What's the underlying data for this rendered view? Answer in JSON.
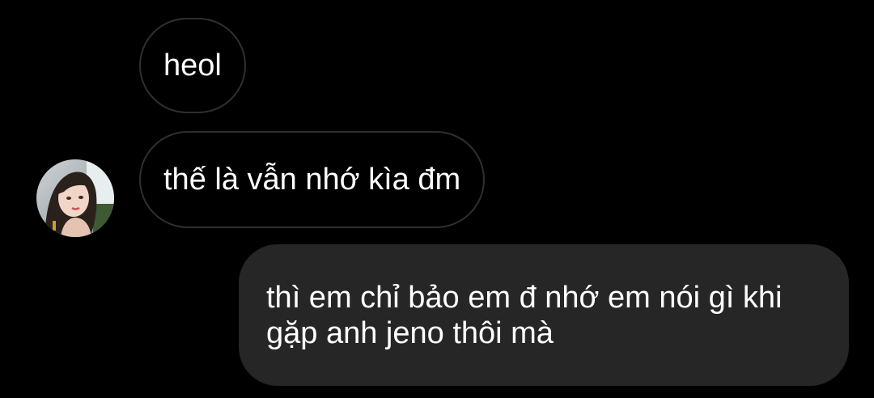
{
  "conversation": {
    "messages": [
      {
        "direction": "received",
        "text": "heol"
      },
      {
        "direction": "received",
        "text": "thế là vẫn nhớ kìa đm"
      },
      {
        "direction": "sent",
        "text": "thì em chỉ bảo em đ nhớ em nói gì khi gặp anh jeno thôi mà"
      }
    ]
  },
  "avatar": {
    "icon": "contact-avatar-photo"
  },
  "colors": {
    "background": "#000000",
    "received_bubble_border": "#2f2f2f",
    "sent_bubble": "#262626",
    "text": "#ffffff"
  }
}
